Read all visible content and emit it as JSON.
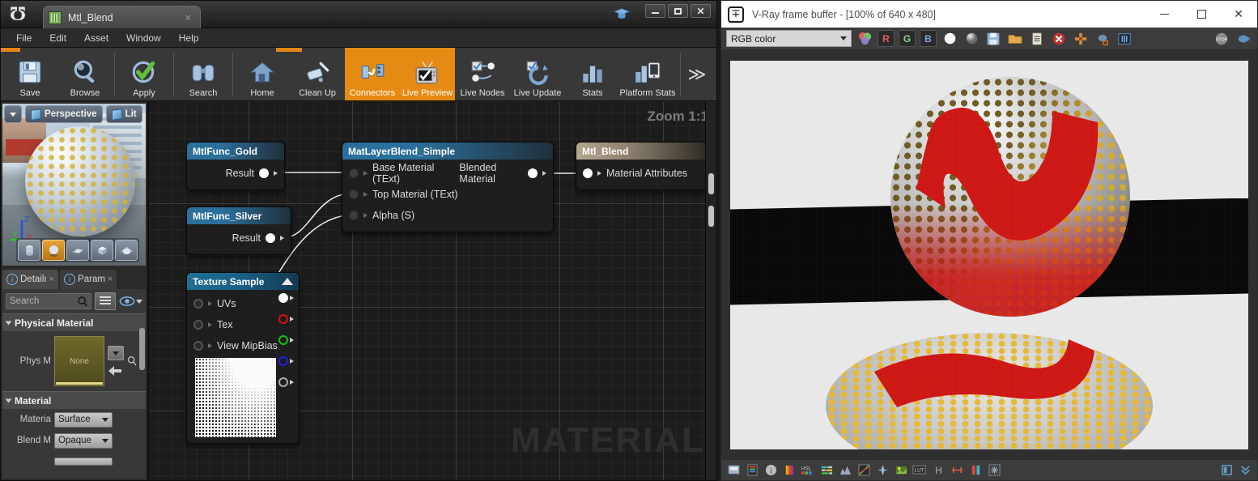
{
  "ue_window": {
    "tab_title": "Mtl_Blend",
    "tab_close": "×",
    "tab_icon": "material-asset-icon",
    "logo_glyph": "Ʊ",
    "window_controls": {
      "minimize": "minimize-icon",
      "maximize": "maximize-icon",
      "close": "✕"
    },
    "menu": [
      "File",
      "Edit",
      "Asset",
      "Window",
      "Help"
    ],
    "toolbar": {
      "items": [
        {
          "label": "Save",
          "icon": "floppy-disk-icon",
          "selected": false
        },
        {
          "label": "Browse",
          "icon": "magnifier-icon",
          "selected": false
        },
        {
          "label": "Apply",
          "icon": "green-check-icon",
          "selected": false
        },
        {
          "label": "Search",
          "icon": "binoculars-icon",
          "selected": false
        },
        {
          "label": "Home",
          "icon": "house-icon",
          "selected": false
        },
        {
          "label": "Clean Up",
          "icon": "broom-icon",
          "selected": false
        },
        {
          "label": "Connectors",
          "icon": "connectors-icon",
          "selected": true
        },
        {
          "label": "Live Preview",
          "icon": "tv-check-icon",
          "selected": true
        },
        {
          "label": "Live Nodes",
          "icon": "node-check-icon",
          "selected": false
        },
        {
          "label": "Live Update",
          "icon": "refresh-check-icon",
          "selected": false
        },
        {
          "label": "Stats",
          "icon": "bar-chart-icon",
          "selected": false
        },
        {
          "label": "Platform Stats",
          "icon": "platform-stats-icon",
          "selected": false
        }
      ],
      "overflow": "≫",
      "accent_color": "#e58a12"
    }
  },
  "viewport": {
    "camera_mode": "Perspective",
    "view_mode": "Lit",
    "caret": "chevron-down-icon",
    "shapes": [
      {
        "name": "cylinder-preview-shape",
        "selected": false
      },
      {
        "name": "sphere-preview-shape",
        "selected": true
      },
      {
        "name": "plane-preview-shape",
        "selected": false
      },
      {
        "name": "cube-preview-shape",
        "selected": false
      },
      {
        "name": "teapot-preview-shape",
        "selected": false
      }
    ],
    "gizmo_axes": [
      "Z",
      "X",
      "Y"
    ]
  },
  "details": {
    "tabs": [
      {
        "label": "Detailı",
        "active": true,
        "close": "×"
      },
      {
        "label": "Param",
        "active": false,
        "close": "×"
      }
    ],
    "search_placeholder": "Search",
    "buttons": {
      "grid": "grid-view-icon",
      "eye": "visibility-icon",
      "caret": "chevron-down-icon"
    },
    "sections": [
      {
        "title": "Physical Material",
        "rows": [
          {
            "label": "Phys M",
            "type": "asset",
            "value": "None"
          }
        ]
      },
      {
        "title": "Material",
        "rows": [
          {
            "label": "Materia",
            "type": "combo",
            "value": "Surface"
          },
          {
            "label": "Blend M",
            "type": "combo",
            "value": "Opaque"
          }
        ]
      }
    ]
  },
  "graph": {
    "zoom_label": "Zoom 1:1",
    "watermark": "MATERIAL",
    "nodes": [
      {
        "title": "MtlFunc_Gold",
        "header_style": "blue",
        "outputs": [
          {
            "label": "Result",
            "pin": "white"
          }
        ],
        "inputs": []
      },
      {
        "title": "MtlFunc_Silver",
        "header_style": "blue",
        "outputs": [
          {
            "label": "Result",
            "pin": "white"
          }
        ],
        "inputs": []
      },
      {
        "title": "MatLayerBlend_Simple",
        "header_style": "blue",
        "inputs": [
          {
            "label": "Base Material (TExt)",
            "pin": "hollow"
          },
          {
            "label": "Top Material (TExt)",
            "pin": "hollow"
          },
          {
            "label": "Alpha (S)",
            "pin": "hollow"
          }
        ],
        "outputs": [
          {
            "label": "Blended Material",
            "pin": "white"
          }
        ]
      },
      {
        "title": "Mtl_Blend",
        "header_style": "tan",
        "inputs": [
          {
            "label": "Material Attributes",
            "pin": "white"
          }
        ],
        "outputs": []
      },
      {
        "title": "Texture Sample",
        "header_style": "cyan",
        "collapse": "collapse-triangle-icon",
        "inputs": [
          {
            "label": "UVs",
            "pin": "hollow"
          },
          {
            "label": "Tex",
            "pin": "hollow"
          },
          {
            "label": "View MipBias",
            "pin": "hollow"
          }
        ],
        "output_pins": [
          "white",
          "red",
          "green",
          "blue",
          "gray"
        ]
      }
    ]
  },
  "vray": {
    "title": "V-Ray frame buffer - [100% of 640 x 480]",
    "logo": "vray-logo-icon",
    "window_controls": {
      "minimize": "minimize-icon",
      "maximize": "maximize-icon",
      "close": "✕"
    },
    "toolbar": {
      "channel_select": "RGB color",
      "channel_caret": "chevron-down-icon",
      "color_wheel": "color-wheel-icon",
      "channels": [
        {
          "label": "R",
          "color": "#e06060"
        },
        {
          "label": "G",
          "color": "#8fd08f"
        },
        {
          "label": "B",
          "color": "#7fa8e0"
        }
      ],
      "icons": [
        "white-sphere-icon",
        "gray-sphere-icon",
        "save-image-icon",
        "open-image-icon",
        "clipboard-icon",
        "clear-image-icon",
        "pan-region-icon",
        "render-teapot-icon",
        "ab-compare-icon"
      ],
      "right_icons": [
        "stop-render-icon",
        "start-render-icon"
      ]
    },
    "render": {
      "resolution": "640 x 480",
      "zoom": "100%"
    },
    "status_icons": [
      "display-correction-icon",
      "color-corrections-icon",
      "info-icon",
      "exposure-icon",
      "hsl-icon",
      "color-balance-icon",
      "levels-icon",
      "curve-icon",
      "white-balance-icon",
      "hue-icon",
      "lut-icon",
      "contrast-h-icon",
      "sharpen-icon",
      "bloom-glare-icon",
      "denoise-icon"
    ],
    "status_right_icons": [
      "layers-panel-icon",
      "expand-icon"
    ]
  }
}
